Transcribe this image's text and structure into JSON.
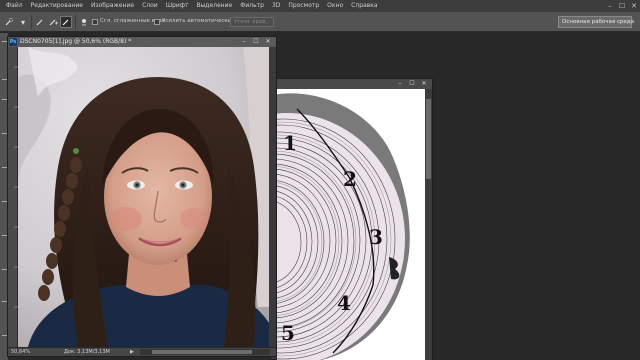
{
  "menu": {
    "items": [
      "Файл",
      "Редактирование",
      "Изображение",
      "Слои",
      "Шрифт",
      "Выделение",
      "Фильтр",
      "3D",
      "Просмотр",
      "Окно",
      "Справка"
    ]
  },
  "window_controls": {
    "minimize": "–",
    "maximize": "☐",
    "close": "✕"
  },
  "options_bar": {
    "anti_alias_label": "Сгл. сглаженные края",
    "auto_enhance_label": "Усилить автоматически",
    "refine_edge_label": "Уточн. край...",
    "workspace": "Основная рабочая среда"
  },
  "doc1": {
    "title": "DSCN0705[1].jpg @ 50,6% (RGB/8) *",
    "ps_badge": "Ps",
    "zoom": "50,64%",
    "doc_size": "Док: 3,13M/3,13M",
    "status_arrow": "▶"
  },
  "doc2": {
    "ring_labels": [
      "1",
      "2",
      "3",
      "4",
      "5"
    ]
  },
  "colors": {
    "menubar": "#3c3c3c",
    "options_bar": "#535353",
    "workspace_bg": "#282828",
    "ps_badge_bg": "#1c3a66",
    "ps_badge_fg": "#6fb4ff"
  }
}
